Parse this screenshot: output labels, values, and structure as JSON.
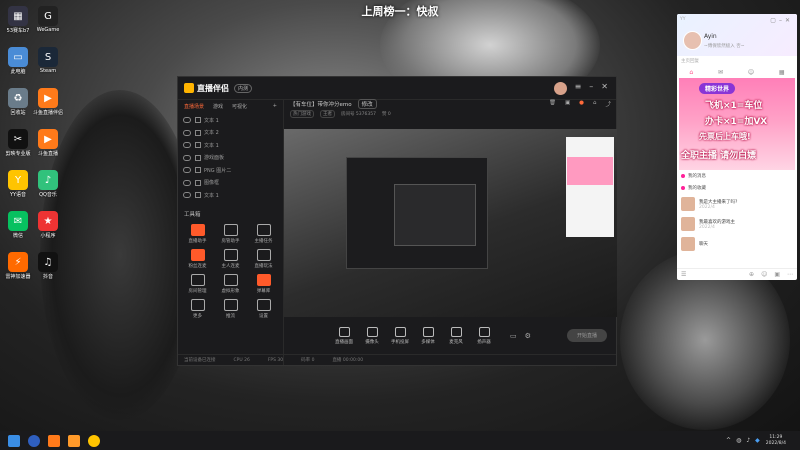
{
  "banner": "上周榜一：快叔",
  "desktop": {
    "icons": [
      {
        "label": "53赛车b7",
        "color": "#334",
        "glyph": "▦"
      },
      {
        "label": "WeGame",
        "color": "#222",
        "glyph": "G"
      },
      {
        "label": "此电脑",
        "color": "#4a8cd6",
        "glyph": "▭"
      },
      {
        "label": "Steam",
        "color": "#1b2838",
        "glyph": "S"
      },
      {
        "label": "回收站",
        "color": "#6a7c8a",
        "glyph": "♻"
      },
      {
        "label": "斗鱼直播伴侣",
        "color": "#ff7a1a",
        "glyph": "▶"
      },
      {
        "label": "剪映专业版",
        "color": "#111",
        "glyph": "✂"
      },
      {
        "label": "斗鱼直播",
        "color": "#ff7a1a",
        "glyph": "▶"
      },
      {
        "label": "YY语音",
        "color": "#ffc400",
        "glyph": "Y"
      },
      {
        "label": "QQ音乐",
        "color": "#31c27c",
        "glyph": "♪"
      },
      {
        "label": "微信",
        "color": "#07c160",
        "glyph": "✉"
      },
      {
        "label": "小程序",
        "color": "#e33",
        "glyph": "★"
      },
      {
        "label": "雷神加速器",
        "color": "#ff6a00",
        "glyph": "⚡"
      },
      {
        "label": "抖音",
        "color": "#111",
        "glyph": "♫"
      }
    ]
  },
  "app": {
    "name": "直播伴侣",
    "version": "内测",
    "tabs": [
      "直播场景",
      "游戏",
      "可视化"
    ],
    "sources": [
      "文本 1",
      "文本 2",
      "文本 1",
      "游戏面板",
      "PNG 图片二",
      "图像框",
      "文本 1"
    ],
    "tools_label": "工具箱",
    "tools": [
      {
        "label": "直播助手",
        "hot": true
      },
      {
        "label": "房管助手",
        "hot": false
      },
      {
        "label": "主播任务",
        "hot": false
      },
      {
        "label": "粉丝连麦",
        "hot": true
      },
      {
        "label": "主人连麦",
        "hot": false
      },
      {
        "label": "直播玩法",
        "hot": false
      },
      {
        "label": "房间管理",
        "hot": false
      },
      {
        "label": "虚拟形象",
        "hot": false
      },
      {
        "label": "弹幕库",
        "hot": true
      },
      {
        "label": "更多",
        "hot": false
      },
      {
        "label": "推流",
        "hot": false
      },
      {
        "label": "设置",
        "hot": false
      }
    ],
    "stream_title": "【有车位】带你冲分emo",
    "edit_label": "修改",
    "meta": [
      "热门游戏",
      "王者",
      "房间号 5376357",
      "赞 0"
    ],
    "bottom_buttons": [
      "直播画面",
      "摄像头",
      "手机投屏",
      "多媒体",
      "麦克风",
      "扬声器"
    ],
    "start_label": "开始直播",
    "status": [
      "当前设备已连接",
      "CPU 26",
      "FPS 30",
      "码率 0",
      "直播 00:00:00"
    ]
  },
  "chat": {
    "app_name": "YY",
    "name": "Ayin",
    "subtitle": "~傅保欣然极入 否~",
    "signature": "主页回复",
    "ad": {
      "tag": "精彩世界",
      "line1": "飞机×1=车位",
      "line2": "办卡×1=加VX",
      "line3": "先票后上车哦!",
      "line4": "全职主播 请勿白嫖"
    },
    "feed_rows": [
      "我的消息",
      "我的收藏"
    ],
    "feed_items": [
      {
        "title": "我是大主播来了吗?",
        "sub": "2022/4"
      },
      {
        "title": "我最喜欢的游戏主",
        "sub": "2022/4"
      },
      {
        "title": "聊天",
        "sub": ""
      }
    ]
  },
  "taskbar": {
    "time": "11:29",
    "date": "2022/8/4"
  }
}
